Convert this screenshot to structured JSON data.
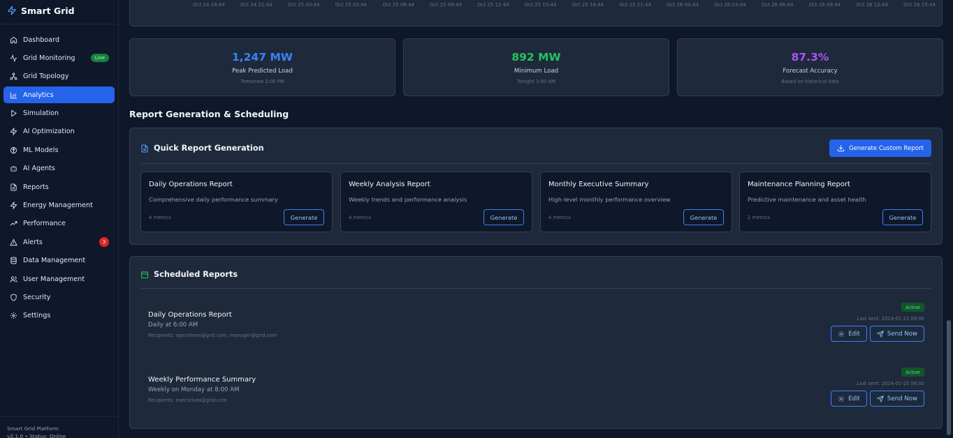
{
  "app": {
    "title": "Smart Grid"
  },
  "sidebar": {
    "items": [
      {
        "label": "Dashboard",
        "icon": "home-icon"
      },
      {
        "label": "Grid Monitoring",
        "icon": "activity-icon",
        "badge": "Live"
      },
      {
        "label": "Grid Topology",
        "icon": "network-icon"
      },
      {
        "label": "Analytics",
        "icon": "bar-chart-icon",
        "active": true
      },
      {
        "label": "Simulation",
        "icon": "play-icon"
      },
      {
        "label": "AI Optimization",
        "icon": "zap-icon"
      },
      {
        "label": "ML Models",
        "icon": "brain-icon"
      },
      {
        "label": "AI Agents",
        "icon": "bot-icon"
      },
      {
        "label": "Reports",
        "icon": "file-icon"
      },
      {
        "label": "Energy Management",
        "icon": "bolt-icon"
      },
      {
        "label": "Performance",
        "icon": "trending-up-icon"
      },
      {
        "label": "Alerts",
        "icon": "alert-triangle-icon",
        "count": "3"
      },
      {
        "label": "Data Management",
        "icon": "database-icon"
      },
      {
        "label": "User Management",
        "icon": "users-icon"
      },
      {
        "label": "Security",
        "icon": "shield-icon"
      },
      {
        "label": "Settings",
        "icon": "gear-icon"
      }
    ],
    "footer": {
      "line1": "Smart Grid Platform",
      "line2": "v2.1.0 • Status: Online"
    }
  },
  "chart": {
    "x_ticks": [
      "Oct 24 18:44",
      "Oct 24 21:44",
      "Oct 25 00:44",
      "Oct 25 03:44",
      "Oct 25 06:44",
      "Oct 25 09:44",
      "Oct 25 12:44",
      "Oct 25 15:44",
      "Oct 25 18:44",
      "Oct 25 21:44",
      "Oct 26 00:44",
      "Oct 26 03:44",
      "Oct 26 06:44",
      "Oct 26 09:44",
      "Oct 26 12:44",
      "Oct 26 15:44"
    ]
  },
  "stats": [
    {
      "value": "1,247 MW",
      "label": "Peak Predicted Load",
      "sub": "Tomorrow 2:00 PM",
      "color": "#3b82f6"
    },
    {
      "value": "892 MW",
      "label": "Minimum Load",
      "sub": "Tonight 3:00 AM",
      "color": "#22c55e"
    },
    {
      "value": "87.3%",
      "label": "Forecast Accuracy",
      "sub": "Based on historical data",
      "color": "#a855f7"
    }
  ],
  "section": {
    "title": "Report Generation & Scheduling"
  },
  "quick": {
    "title": "Quick Report Generation",
    "generate_custom": "Generate Custom Report",
    "reports": [
      {
        "title": "Daily Operations Report",
        "desc": "Comprehensive daily performance summary",
        "meta": "4 metrics",
        "button": "Generate"
      },
      {
        "title": "Weekly Analysis Report",
        "desc": "Weekly trends and performance analysis",
        "meta": "4 metrics",
        "button": "Generate"
      },
      {
        "title": "Monthly Executive Summary",
        "desc": "High-level monthly performance overview",
        "meta": "4 metrics",
        "button": "Generate"
      },
      {
        "title": "Maintenance Planning Report",
        "desc": "Predictive maintenance and asset health",
        "meta": "2 metrics",
        "button": "Generate"
      }
    ]
  },
  "scheduled": {
    "title": "Scheduled Reports",
    "items": [
      {
        "title": "Daily Operations Report",
        "freq": "Daily at 6:00 AM",
        "recipients": "Recipients: operations@grid.com, manager@grid.com",
        "status": "Active",
        "last": "Last sent: 2024-01-15 06:00",
        "edit": "Edit",
        "send": "Send Now"
      },
      {
        "title": "Weekly Performance Summary",
        "freq": "Weekly on Monday at 8:00 AM",
        "recipients": "Recipients: executives@grid.com",
        "status": "Active",
        "last": "Last sent: 2024-01-15 08:00",
        "edit": "Edit",
        "send": "Send Now"
      }
    ]
  }
}
